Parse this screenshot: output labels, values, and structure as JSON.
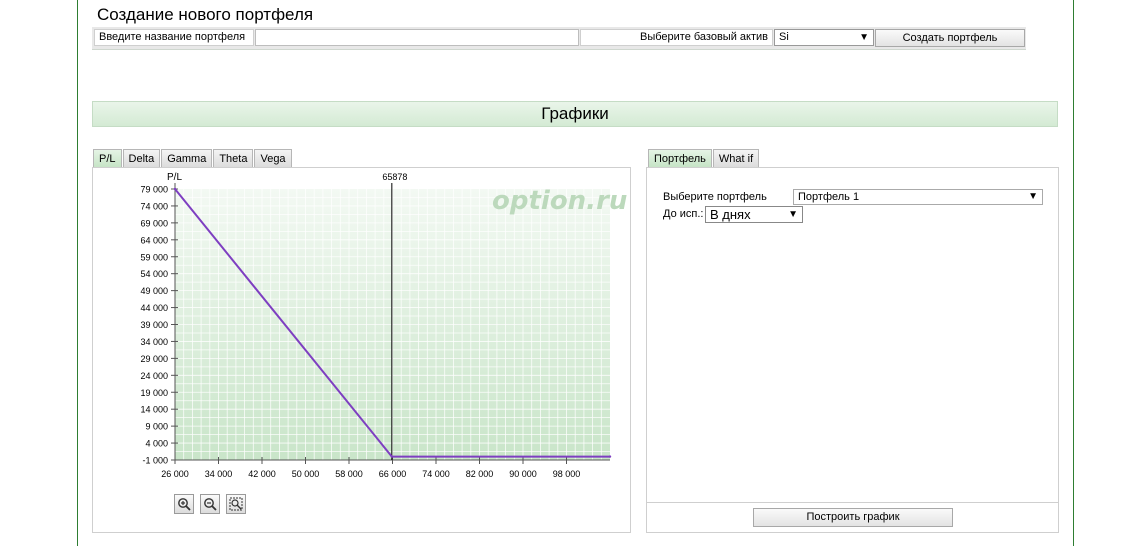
{
  "page": {
    "title": "Создание нового портфеля",
    "create_bar": {
      "name_label": "Введите название портфеля",
      "name_value": "",
      "asset_label": "Выберите базовый актив",
      "asset_value": "Si",
      "create_button": "Создать портфель"
    },
    "graphs_title": "Графики"
  },
  "chart_tabs": [
    "P/L",
    "Delta",
    "Gamma",
    "Theta",
    "Vega"
  ],
  "chart_active_tab": "P/L",
  "right_tabs": [
    "Портфель",
    "What if"
  ],
  "right_active_tab": "Портфель",
  "right_panel": {
    "portfolio_label": "Выберите портфель",
    "portfolio_value": "Портфель 1",
    "expiry_label": "До исп.:",
    "expiry_value": "В днях",
    "build_button": "Построить график"
  },
  "watermark": "option.ru",
  "colors": {
    "line": "#7e3fc1",
    "baseline": "#3a3ae0",
    "grid_bg_top": "#f3f9f3",
    "grid_bg_bottom": "#c9e5c9",
    "frame": "#2e7d32"
  },
  "chart_data": {
    "type": "line",
    "ylabel": "P/L",
    "xlim": [
      26000,
      106000
    ],
    "ylim": [
      -1000,
      79000
    ],
    "y_ticks": [
      79000,
      74000,
      69000,
      64000,
      59000,
      54000,
      49000,
      44000,
      39000,
      34000,
      29000,
      24000,
      19000,
      14000,
      9000,
      4000,
      -1000
    ],
    "y_tick_labels": [
      "79 000",
      "74 000",
      "69 000",
      "64 000",
      "59 000",
      "54 000",
      "49 000",
      "44 000",
      "39 000",
      "34 000",
      "29 000",
      "24 000",
      "19 000",
      "14 000",
      "9 000",
      "4 000",
      "-1 000"
    ],
    "x_ticks": [
      26000,
      34000,
      42000,
      50000,
      58000,
      66000,
      74000,
      82000,
      90000,
      98000
    ],
    "x_tick_labels": [
      "26 000",
      "34 000",
      "42 000",
      "50 000",
      "58 000",
      "66 000",
      "74 000",
      "82 000",
      "90 000",
      "98 000"
    ],
    "current_price": 65878,
    "current_price_label": "65878",
    "grid": true,
    "series": [
      {
        "values": [
          [
            26000,
            79000
          ],
          [
            65878,
            0
          ],
          [
            106000,
            0
          ]
        ]
      }
    ]
  }
}
